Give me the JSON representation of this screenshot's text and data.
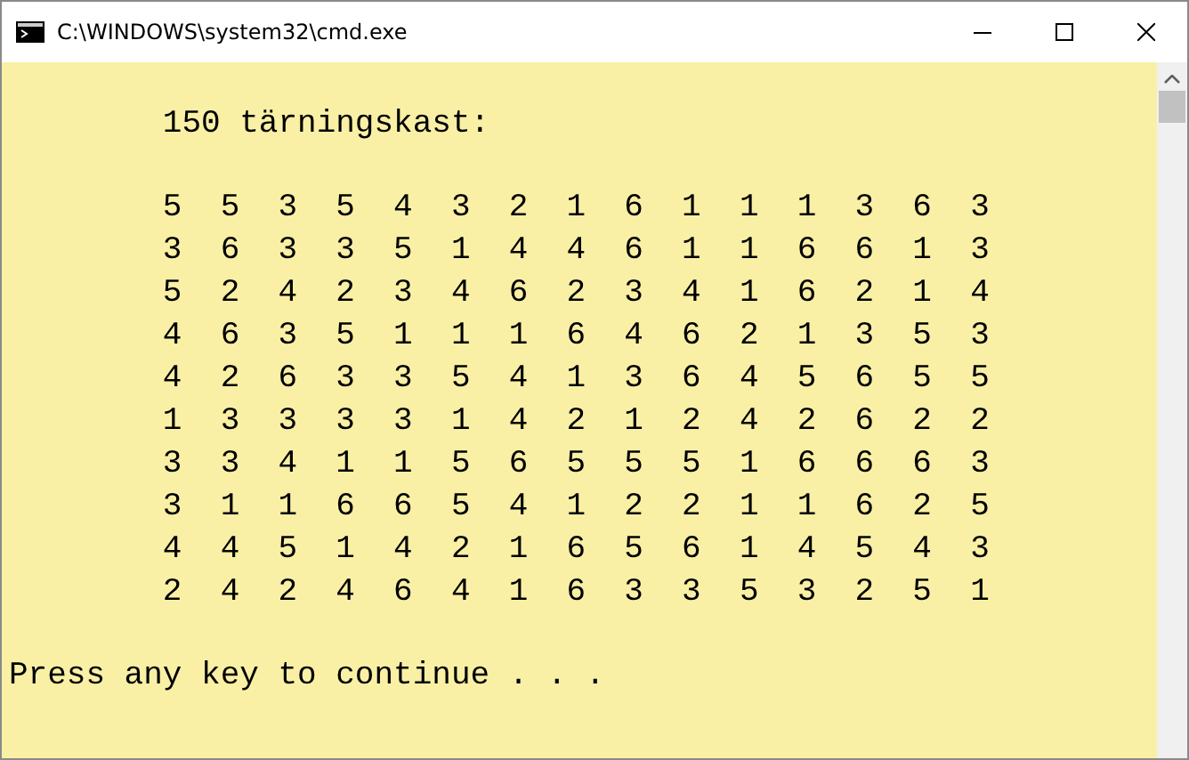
{
  "window": {
    "title": "C:\\WINDOWS\\system32\\cmd.exe"
  },
  "console": {
    "heading": "        150 tärningskast:",
    "rows": [
      "        5  5  3  5  4  3  2  1  6  1  1  1  3  6  3",
      "        3  6  3  3  5  1  4  4  6  1  1  6  6  1  3",
      "        5  2  4  2  3  4  6  2  3  4  1  6  2  1  4",
      "        4  6  3  5  1  1  1  6  4  6  2  1  3  5  3",
      "        4  2  6  3  3  5  4  1  3  6  4  5  6  5  5",
      "        1  3  3  3  3  1  4  2  1  2  4  2  6  2  2",
      "        3  3  4  1  1  5  6  5  5  5  1  6  6  6  3",
      "        3  1  1  6  6  5  4  1  2  2  1  1  6  2  5",
      "        4  4  5  1  4  2  1  6  5  6  1  4  5  4  3",
      "        2  4  2  4  6  4  1  6  3  3  5  3  2  5  1"
    ],
    "prompt": "Press any key to continue . . ."
  }
}
